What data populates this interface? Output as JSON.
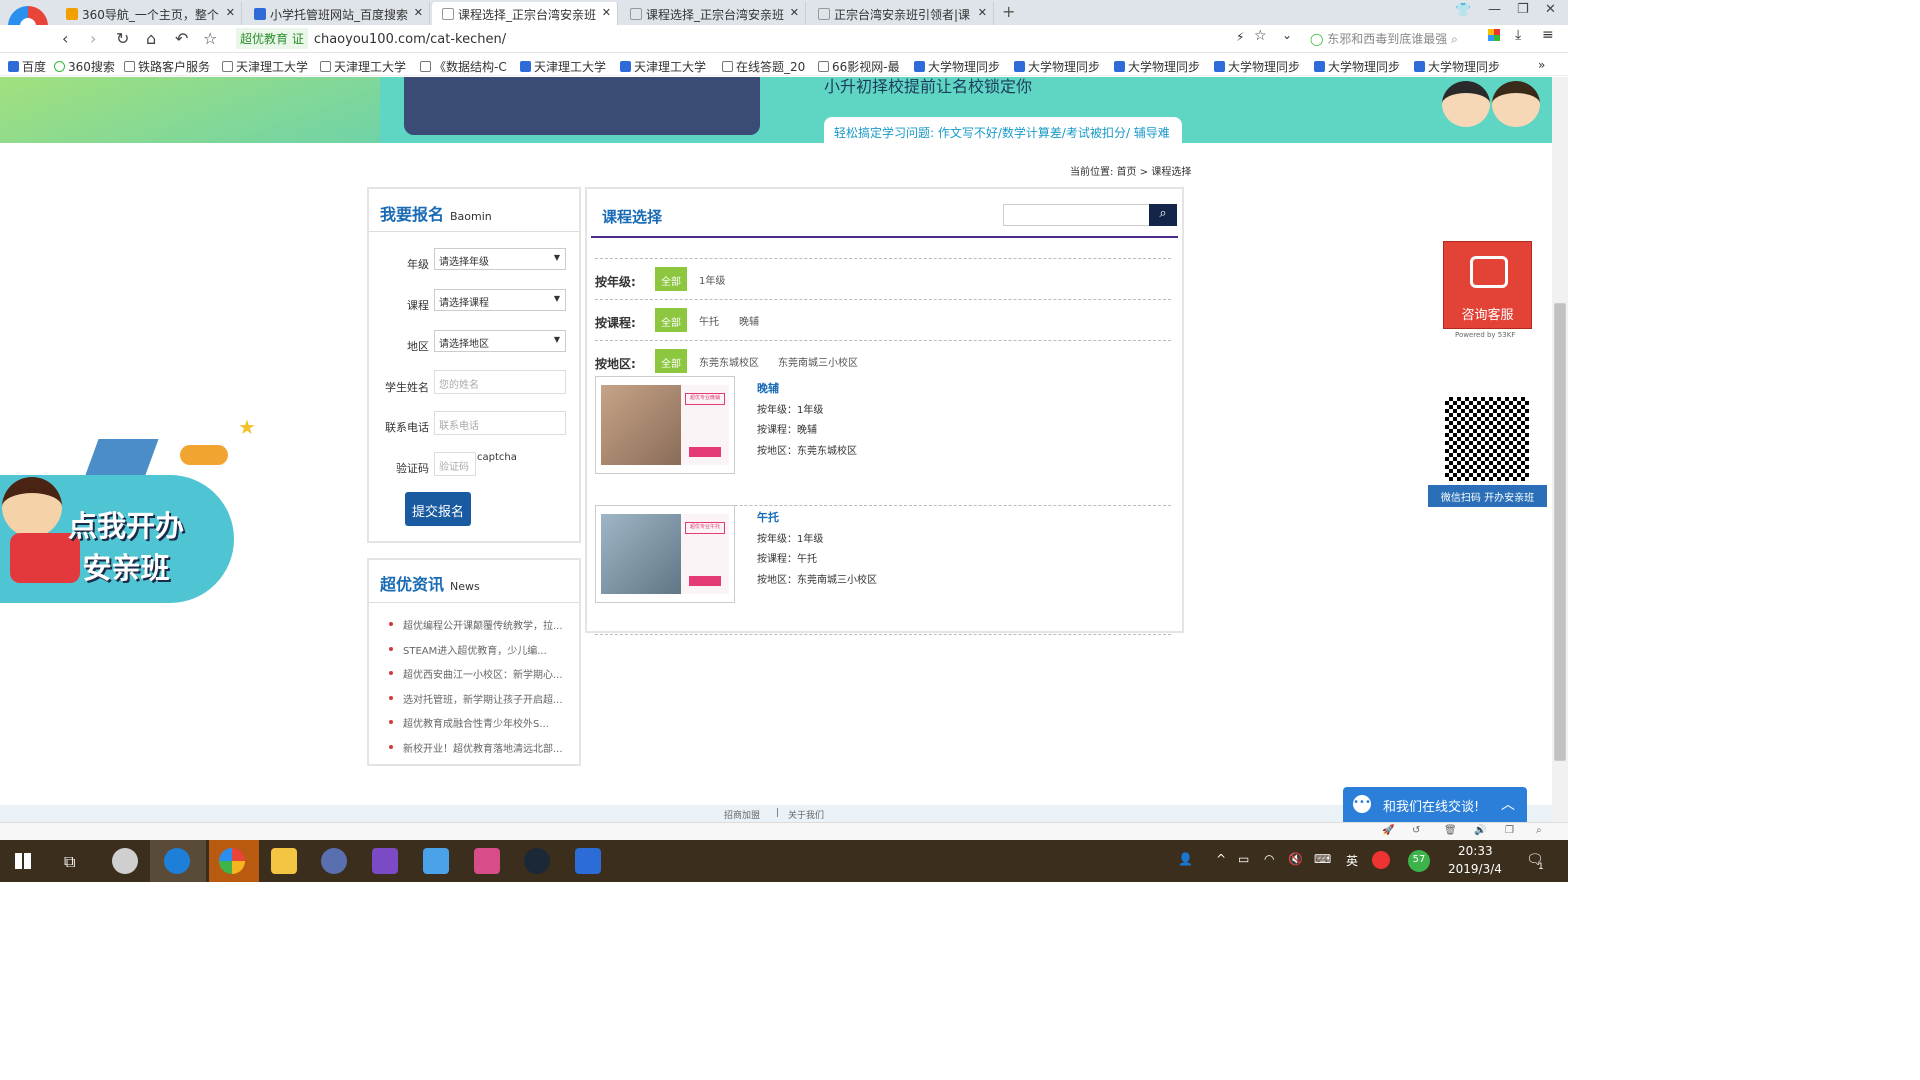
{
  "tabs": [
    {
      "label": "360导航_一个主页，整个",
      "color": "#f0a000"
    },
    {
      "label": "小学托管班网站_百度搜索",
      "color": "#2e6bd9"
    },
    {
      "label": "课程选择_正宗台湾安亲班",
      "color": "#ffffff"
    },
    {
      "label": "课程选择_正宗台湾安亲班",
      "color": "#ffffff"
    },
    {
      "label": "正宗台湾安亲班引领者|课",
      "color": "#ffffff"
    }
  ],
  "address": {
    "cert": "超优教育 证",
    "url": "chaoyou100.com/cat-kechen/"
  },
  "search_hint": "东邪和西毒到底谁最强",
  "bookmarks": [
    "百度",
    "360搜索",
    "铁路客户服务",
    "天津理工大学",
    "天津理工大学",
    "《数据结构-C",
    "天津理工大学",
    "天津理工大学",
    "在线答题_20",
    "66影视网-最",
    "大学物理同步",
    "大学物理同步",
    "大学物理同步",
    "大学物理同步",
    "大学物理同步",
    "大学物理同步"
  ],
  "banner": {
    "line1": "小升初择校提前让名校锁定你",
    "line2": "轻松搞定学习问题: 作文写不好/数学计算差/考试被扣分/ 辅导难"
  },
  "breadcrumb": {
    "prefix": "当前位置:",
    "home": "首页",
    "sep": ">",
    "current": "课程选择"
  },
  "signup": {
    "title": "我要报名",
    "subtitle": "Baomin",
    "grade_label": "年级",
    "grade_value": "请选择年级",
    "course_label": "课程",
    "course_value": "请选择课程",
    "area_label": "地区",
    "area_value": "请选择地区",
    "name_label": "学生姓名",
    "name_placeholder": "您的姓名",
    "phone_label": "联系电话",
    "phone_placeholder": "联系电话",
    "captcha_label": "验证码",
    "captcha_placeholder": "验证码",
    "captcha_alt": "captcha",
    "submit": "提交报名"
  },
  "news": {
    "title": "超优资讯",
    "subtitle": "News",
    "items": [
      "超优编程公开课颠覆传统教学，拉...",
      "STEAM进入超优教育，少儿编...",
      "超优西安曲江一小校区：新学期心...",
      "选对托管班，新学期让孩子开启超...",
      "超优教育成融合性青少年校外S...",
      "新校开业！超优教育落地清远北部..."
    ]
  },
  "courses_panel": {
    "title": "课程选择",
    "filters": [
      {
        "label": "按年级:",
        "all": "全部",
        "options": [
          "1年级"
        ]
      },
      {
        "label": "按课程:",
        "all": "全部",
        "options": [
          "午托",
          "晚辅"
        ]
      },
      {
        "label": "按地区:",
        "all": "全部",
        "options": [
          "东莞东城校区",
          "东莞南城三小校区"
        ]
      }
    ],
    "items": [
      {
        "title": "晚辅",
        "grade": "按年级：1年级",
        "course": "按课程：晚辅",
        "area": "按地区：东莞东城校区",
        "card_text": "超优专业晚辅"
      },
      {
        "title": "午托",
        "grade": "按年级：1年级",
        "course": "按课程：午托",
        "area": "按地区：东莞南城三小校区",
        "card_text": "超优专业午托"
      }
    ]
  },
  "side": {
    "service": "咨询客服",
    "powered": "Powered by 53KF",
    "qr_caption": "微信扫码 开办安亲班",
    "promo": "点我开办安亲班"
  },
  "chat": {
    "label": "和我们在线交谈!"
  },
  "footer_links": [
    "招商加盟",
    "|",
    "关于我们"
  ],
  "taskbar": {
    "time": "20:33",
    "date": "2019/3/4",
    "lang": "英",
    "badge": "57",
    "notif": "1"
  },
  "colors": {
    "accent": "#1a6bb5",
    "green": "#8dc63f",
    "banner": "#5fd6c4",
    "service": "#e34236",
    "chat": "#2b7fd8"
  }
}
